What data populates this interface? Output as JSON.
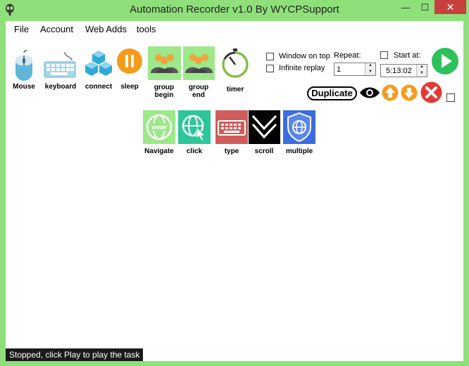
{
  "window": {
    "title": "Automation Recorder v1.0 By WYCPSupport",
    "min_glyph": "—",
    "max_glyph": "☐",
    "close_glyph": "✕"
  },
  "menu": [
    "File",
    "Account",
    "Web Adds",
    "tools"
  ],
  "tools_row1": [
    {
      "name": "mouse",
      "label": "Mouse"
    },
    {
      "name": "keyboard",
      "label": "keyboard"
    },
    {
      "name": "connect",
      "label": "connect"
    },
    {
      "name": "sleep",
      "label": "sleep"
    },
    {
      "name": "group-begin",
      "label": "group\nbegin"
    },
    {
      "name": "group-end",
      "label": "group\nend"
    },
    {
      "name": "timer",
      "label": "timer"
    }
  ],
  "tools_row2": [
    {
      "name": "navigate",
      "label": "Navigate",
      "icon_text": "www"
    },
    {
      "name": "click",
      "label": "click"
    },
    {
      "name": "type",
      "label": "type"
    },
    {
      "name": "scroll",
      "label": "scroll"
    },
    {
      "name": "multiple",
      "label": "multiple"
    }
  ],
  "options": {
    "window_on_top": {
      "label": "Window on top",
      "checked": false
    },
    "infinite_replay": {
      "label": "Infinite replay",
      "checked": false
    },
    "repeat_label": "Repeat:",
    "repeat_value": "1",
    "start_at_label": "Start at:",
    "start_at_checked": false,
    "start_at_value": "5:13:02"
  },
  "duplicate_label": "Duplicate",
  "status": "Stopped, click Play to play the task",
  "colors": {
    "frame": "#8fe07a",
    "close": "#c7403c",
    "play": "#2ec05a",
    "orange": "#f59b1c",
    "red": "#e53935",
    "type_tile": "#cf5c5c",
    "multiple_tile": "#3a6de0"
  }
}
